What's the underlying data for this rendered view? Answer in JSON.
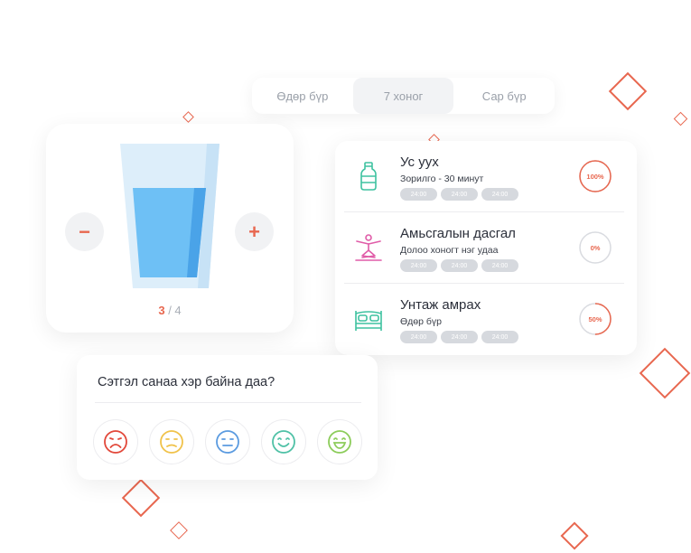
{
  "period_tabs": [
    {
      "label": "Өдөр бүр",
      "active": false
    },
    {
      "label": "7 хоног",
      "active": true
    },
    {
      "label": "Сар бүр",
      "active": false
    }
  ],
  "water": {
    "current": "3",
    "separator": " / ",
    "goal": "4",
    "minus_label": "−",
    "plus_label": "+",
    "fill_fraction": 0.75,
    "glass_icon": "water-glass-icon"
  },
  "habits": [
    {
      "title": "Ус уух",
      "subtitle": "Зорилго - 30 минут",
      "times": [
        "24:00",
        "24:00",
        "24:00"
      ],
      "progress_label": "100%",
      "progress": 1.0,
      "icon": "water-bottle-icon"
    },
    {
      "title": "Амьсгалын дасгал",
      "subtitle": "Долоо хоногт нэг удаа",
      "times": [
        "24:00",
        "24:00",
        "24:00"
      ],
      "progress_label": "0%",
      "progress": 0.0,
      "icon": "yoga-pose-icon"
    },
    {
      "title": "Унтаж амрах",
      "subtitle": "Өдөр бүр",
      "times": [
        "24:00",
        "24:00",
        "24:00"
      ],
      "progress_label": "50%",
      "progress": 0.5,
      "icon": "bed-icon"
    }
  ],
  "mood": {
    "question": "Сэтгэл санаа хэр байна даа?",
    "faces": [
      {
        "name": "very-sad-face-icon",
        "color": "#e2483a"
      },
      {
        "name": "sad-face-icon",
        "color": "#f0c24a"
      },
      {
        "name": "neutral-face-icon",
        "color": "#5b9be0"
      },
      {
        "name": "happy-face-icon",
        "color": "#4fc1a6"
      },
      {
        "name": "very-happy-face-icon",
        "color": "#8ccc5a"
      }
    ]
  },
  "colors": {
    "accent": "#e8674f",
    "water": "#6ec0f5",
    "habit_icon": "#3ec2a0",
    "yoga_icon": "#e05ca8",
    "ring_track": "#d9dbe0"
  }
}
